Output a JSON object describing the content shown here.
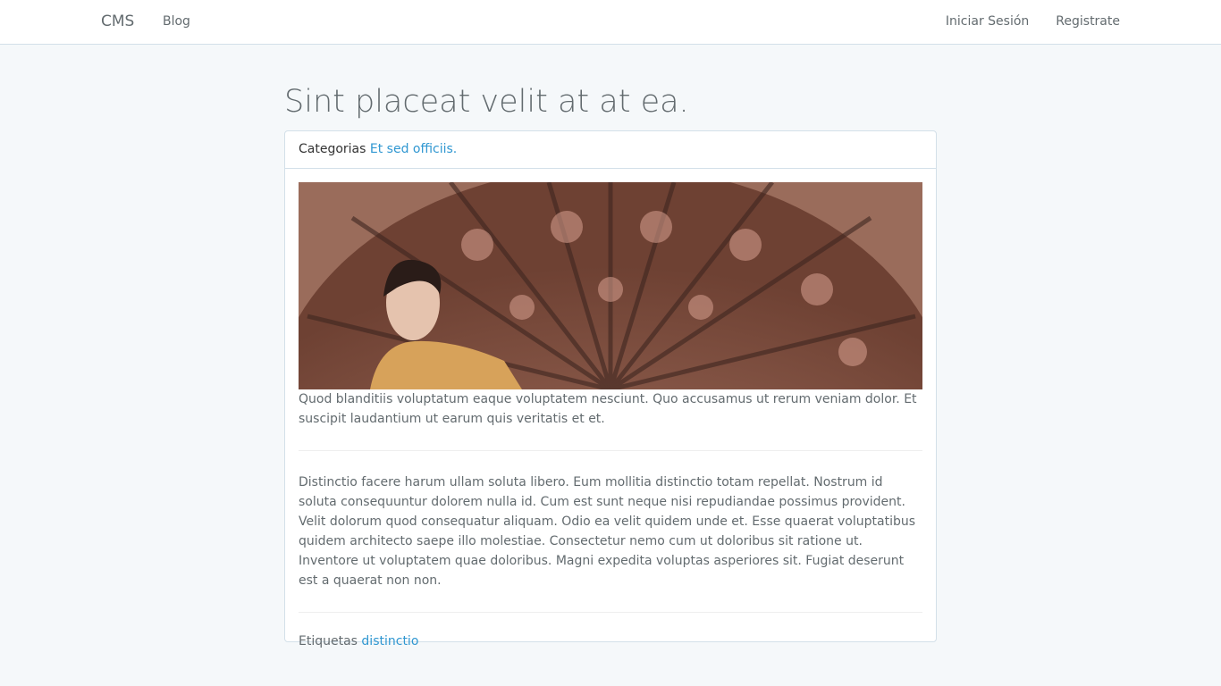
{
  "navbar": {
    "brand": "CMS",
    "blog_link": "Blog",
    "login_link": "Iniciar Sesión",
    "register_link": "Registrate"
  },
  "post": {
    "title": "Sint placeat velit at at ea.",
    "category_label": "Categorias",
    "category_link": "Et sed officiis.",
    "excerpt": "Quod blanditiis voluptatum eaque voluptatem nesciunt. Quo accusamus ut rerum veniam dolor. Et suscipit laudantium ut earum quis veritatis et et.",
    "body": "Distinctio facere harum ullam soluta libero. Eum mollitia distinctio totam repellat. Nostrum id soluta consequuntur dolorem nulla id. Cum est sunt neque nisi repudiandae possimus provident. Velit dolorum quod consequatur aliquam. Odio ea velit quidem unde et. Esse quaerat voluptatibus quidem architecto saepe illo molestiae. Consectetur nemo cum ut doloribus sit ratione ut. Inventore ut voluptatem quae doloribus. Magni expedita voluptas asperiores sit. Fugiat deserunt est a quaerat non non.",
    "tags_label": "Etiquetas",
    "tag": "distinctio"
  },
  "colors": {
    "link": "#3097d1",
    "background": "#f5f8fa",
    "text": "#636b6f"
  }
}
